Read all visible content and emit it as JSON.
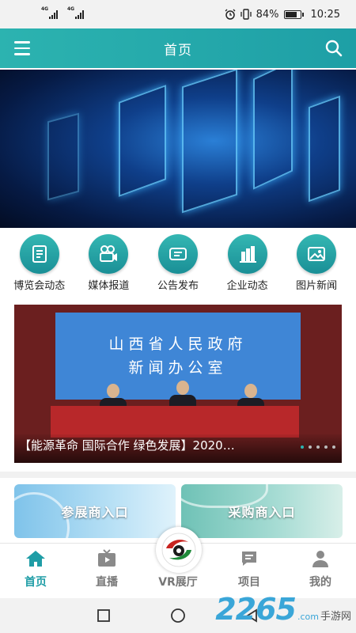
{
  "status_bar": {
    "signal_1_tag": "4G",
    "signal_2_tag": "4G",
    "battery_percent": "84%",
    "battery_level": 0.84,
    "time": "10:25"
  },
  "header": {
    "title": "首页",
    "color": "#2cb3b0"
  },
  "quick_links": [
    {
      "label": "博览会动态",
      "icon": "document-icon"
    },
    {
      "label": "媒体报道",
      "icon": "video-camera-icon"
    },
    {
      "label": "公告发布",
      "icon": "announcement-icon"
    },
    {
      "label": "企业动态",
      "icon": "building-icon"
    },
    {
      "label": "图片新闻",
      "icon": "image-icon"
    }
  ],
  "news": {
    "backdrop_line_1": "山西省人民政府",
    "backdrop_line_2": "新闻办公室",
    "caption": "【能源革命 国际合作 绿色发展】2020…",
    "slide_count": 5,
    "active_slide": 1
  },
  "entries": {
    "exhibitor_label": "参展商入口",
    "buyer_label": "采购商入口"
  },
  "bottom_nav": [
    {
      "label": "首页",
      "icon": "home-icon",
      "active": true
    },
    {
      "label": "直播",
      "icon": "tv-icon",
      "active": false
    },
    {
      "label": "VR展厅",
      "icon": "vr-logo-icon",
      "active": false
    },
    {
      "label": "项目",
      "icon": "project-icon",
      "active": false
    },
    {
      "label": "我的",
      "icon": "user-icon",
      "active": false
    }
  ],
  "watermark": {
    "number": "2265",
    "suffix": ".com",
    "text": "手游网"
  }
}
